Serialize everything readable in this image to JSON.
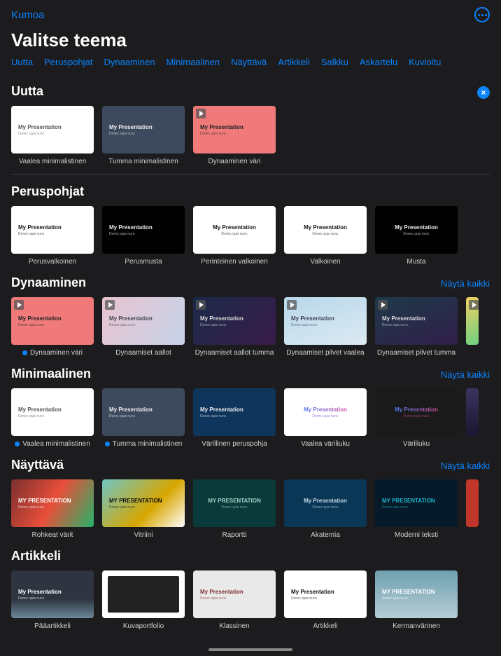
{
  "topbar": {
    "cancel": "Kumoa"
  },
  "title": "Valitse teema",
  "categories": [
    "Uutta",
    "Peruspohjat",
    "Dynaaminen",
    "Minimaalinen",
    "Näyttävä",
    "Artikkeli",
    "Salkku",
    "Askartelu",
    "Kuvioitu"
  ],
  "show_all_label": "Näytä kaikki",
  "thumb_title": "My Presentation",
  "thumb_sub": "Donec quis nunc",
  "thumb_upper": "MY PRESENTATION",
  "sections": {
    "uutta": {
      "heading": "Uutta",
      "closable": true,
      "items": [
        {
          "label": "Vaalea minimalistinen",
          "bg": "#ffffff",
          "fg": "#555",
          "align": "left",
          "badge": false,
          "marked": false
        },
        {
          "label": "Tumma minimalistinen",
          "bg": "#3d4a5e",
          "fg": "#eee",
          "align": "left",
          "badge": false,
          "marked": false
        },
        {
          "label": "Dynaaminen väri",
          "bg": "#f07a7a",
          "fg": "#222",
          "align": "left",
          "badge": true,
          "marked": false
        }
      ]
    },
    "perus": {
      "heading": "Peruspohjat",
      "items": [
        {
          "label": "Perusvalkoinen",
          "bg": "#ffffff",
          "fg": "#111",
          "align": "left"
        },
        {
          "label": "Perusmusta",
          "bg": "#000000",
          "fg": "#eee",
          "align": "left"
        },
        {
          "label": "Perinteinen valkoinen",
          "bg": "#ffffff",
          "fg": "#111",
          "align": "center"
        },
        {
          "label": "Valkoinen",
          "bg": "#ffffff",
          "fg": "#111",
          "align": "center"
        },
        {
          "label": "Musta",
          "bg": "#000000",
          "fg": "#eee",
          "align": "center"
        }
      ]
    },
    "dyn": {
      "heading": "Dynaaminen",
      "show_all": true,
      "items": [
        {
          "label": "Dynaaminen väri",
          "bg": "#f07a7a",
          "fg": "#222",
          "align": "left",
          "badge": true,
          "marked": true
        },
        {
          "label": "Dynaamiset aallot",
          "bg": "linear-gradient(120deg,#e8c3d0,#c6d3e8)",
          "fg": "#445",
          "align": "left",
          "badge": true
        },
        {
          "label": "Dynaamiset aallot tumma",
          "bg": "linear-gradient(135deg,#1b2a4a,#3a1b4a)",
          "fg": "#ddd",
          "align": "left",
          "badge": true
        },
        {
          "label": "Dynaamiset pilvet vaalea",
          "bg": "linear-gradient(160deg,#b7d8ea,#dce9f3)",
          "fg": "#445",
          "align": "left",
          "badge": true
        },
        {
          "label": "Dynaamiset pilvet tumma",
          "bg": "linear-gradient(160deg,#1e3a4a,#311e4a)",
          "fg": "#ddd",
          "align": "left",
          "badge": true
        },
        {
          "label": "",
          "bg": "linear-gradient(160deg,#f0d060,#6fd080)",
          "fg": "#222",
          "align": "left",
          "badge": true,
          "partial": true
        }
      ]
    },
    "min": {
      "heading": "Minimaalinen",
      "show_all": true,
      "items": [
        {
          "label": "Vaalea minimalistinen",
          "bg": "#ffffff",
          "fg": "#555",
          "align": "left",
          "marked": true
        },
        {
          "label": "Tumma minimalistinen",
          "bg": "#3d4a5e",
          "fg": "#eee",
          "align": "left",
          "marked": true
        },
        {
          "label": "Värillinen peruspohja",
          "bg": "#10355c",
          "fg": "#eee",
          "align": "left"
        },
        {
          "label": "Vaalea väriliuku",
          "bg": "#ffffff",
          "fg": "#7a3fe0",
          "align": "center",
          "gradtext": true
        },
        {
          "label": "Väriliuku",
          "bg": "#1a1a1a",
          "fg": "#d04f9a",
          "align": "center",
          "gradtext": true
        },
        {
          "label": "",
          "bg": "linear-gradient(180deg,#3a3560,#1a1530)",
          "fg": "#fff",
          "align": "center",
          "partial": true
        }
      ]
    },
    "nay": {
      "heading": "Näyttävä",
      "show_all": true,
      "items": [
        {
          "label": "Rohkeat värit",
          "cls": "photo1",
          "fg": "#fff",
          "align": "left",
          "upper": true
        },
        {
          "label": "Vitriini",
          "cls": "photo2",
          "fg": "#111",
          "align": "left",
          "upper": true
        },
        {
          "label": "Raportti",
          "cls": "photo3",
          "fg": "#a0d0c8",
          "align": "center",
          "upper": true
        },
        {
          "label": "Akatemia",
          "cls": "photo4",
          "fg": "#c0d8e8",
          "align": "center"
        },
        {
          "label": "Moderni teksti",
          "cls": "photo5",
          "fg": "#1fb5c9",
          "align": "left",
          "upper": true
        },
        {
          "label": "",
          "bg": "#c0362a",
          "fg": "#fff",
          "align": "left",
          "partial": true
        }
      ]
    },
    "art": {
      "heading": "Artikkeli",
      "items": [
        {
          "label": "Pääartikkeli",
          "cls": "photo-art1",
          "fg": "#fff",
          "align": "left"
        },
        {
          "label": "Kuvaportfolio",
          "cls": "photo-art2",
          "fg": "#fff",
          "align": "center"
        },
        {
          "label": "Klassinen",
          "cls": "photo-art3",
          "fg": "#803030",
          "align": "left"
        },
        {
          "label": "Artikkeli",
          "cls": "photo-art4",
          "fg": "#111",
          "align": "left"
        },
        {
          "label": "Kermanvärinen",
          "cls": "photo-art5",
          "fg": "#fff",
          "align": "left",
          "upper": true
        }
      ]
    }
  }
}
